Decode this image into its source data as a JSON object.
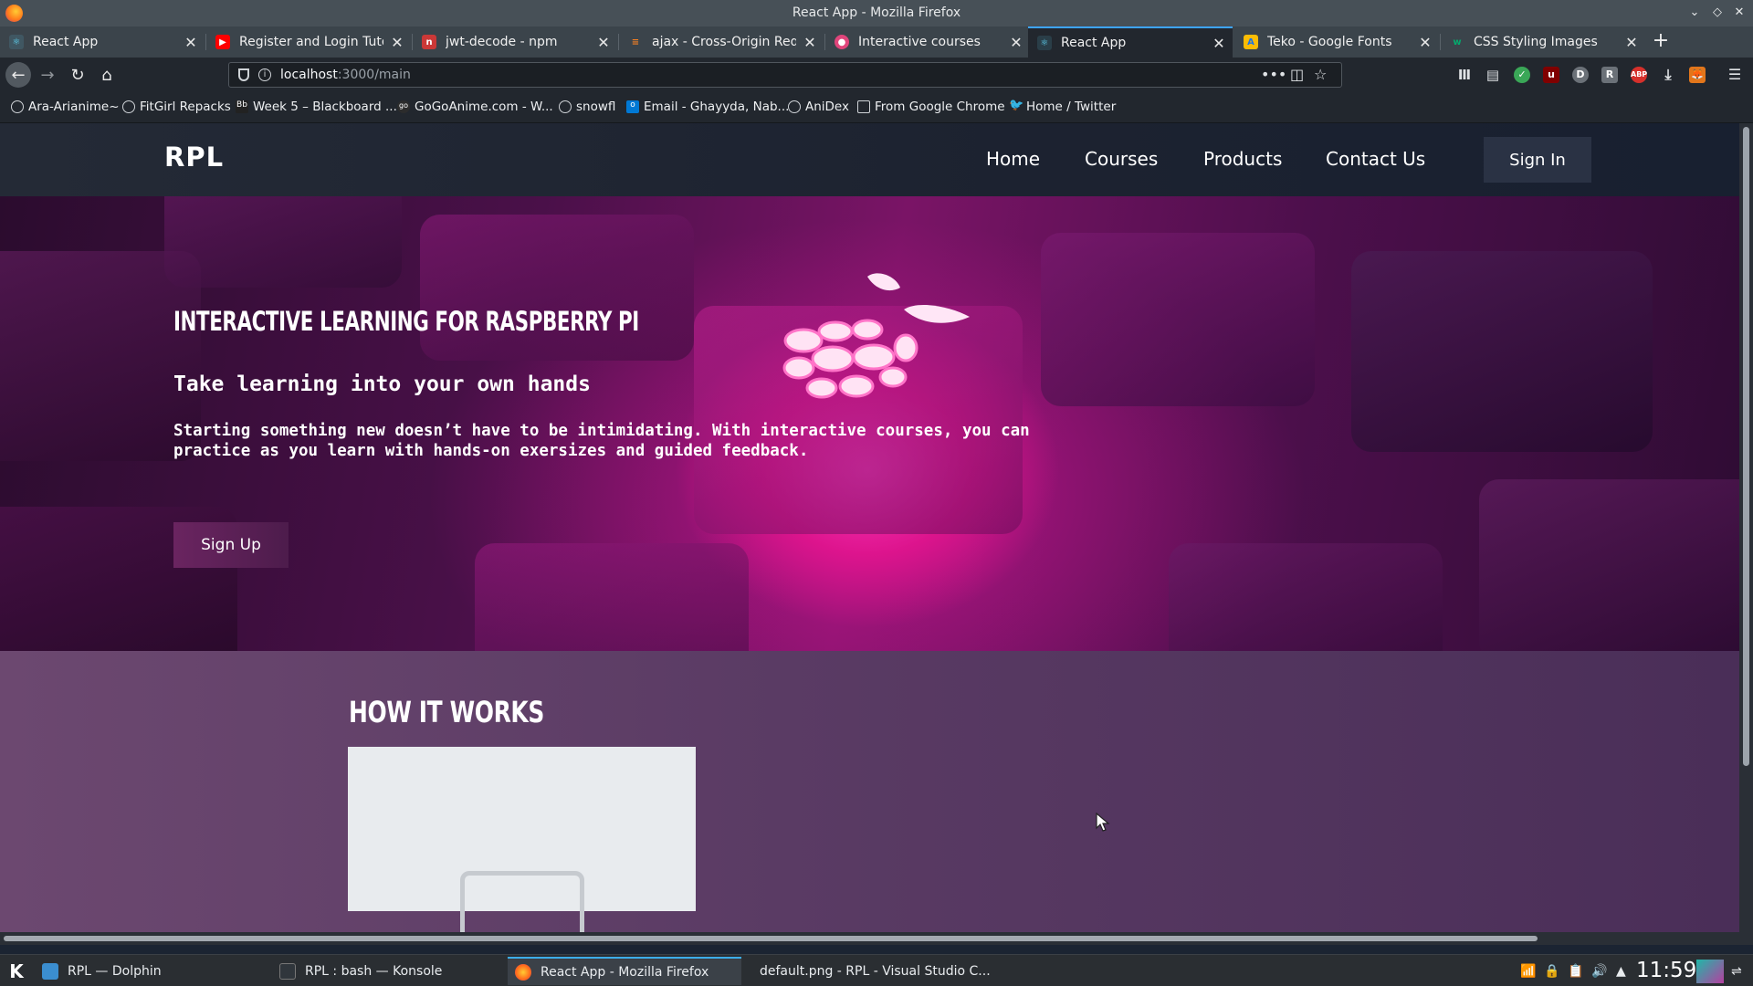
{
  "window": {
    "title": "React App - Mozilla Firefox"
  },
  "tabs": [
    {
      "label": "React App",
      "active": false,
      "favicon_color": "#61dafb"
    },
    {
      "label": "Register and Login Tutoria",
      "active": false,
      "favicon_color": "#ff0000"
    },
    {
      "label": "jwt-decode - npm",
      "active": false,
      "favicon_color": "#cb3837"
    },
    {
      "label": "ajax - Cross-Origin Reque",
      "active": false,
      "favicon_color": "#f48024"
    },
    {
      "label": "Interactive courses",
      "active": false,
      "favicon_color": "#e0457b"
    },
    {
      "label": "React App",
      "active": true,
      "favicon_color": "#61dafb"
    },
    {
      "label": "Teko - Google Fonts",
      "active": false,
      "favicon_color": "#fbbc04"
    },
    {
      "label": "CSS Styling Images",
      "active": false,
      "favicon_color": "#04aa6d"
    }
  ],
  "urlbar": {
    "host": "localhost",
    "path": ":3000/main"
  },
  "bookmarks": [
    {
      "label": "Ara-Arianime~"
    },
    {
      "label": "FitGirl Repacks"
    },
    {
      "label": "Week 5 – Blackboard ..."
    },
    {
      "label": "GoGoAnime.com - W..."
    },
    {
      "label": "snowfl"
    },
    {
      "label": "Email - Ghayyda, Nab..."
    },
    {
      "label": "AniDex"
    },
    {
      "label": "From Google Chrome"
    },
    {
      "label": "Home / Twitter"
    }
  ],
  "site": {
    "logo": "RPL",
    "nav": [
      "Home",
      "Courses",
      "Products",
      "Contact Us"
    ],
    "signin": "Sign In",
    "hero": {
      "title": "INTERACTIVE LEARNING FOR RASPBERRY PI",
      "subtitle": "Take learning into your own hands",
      "text": "Starting something new doesn’t have to be intimidating. With interactive courses, you can practice as you learn with hands-on exersizes and guided feedback.",
      "signup": "Sign Up"
    },
    "how_title": "HOW IT WORKS"
  },
  "taskbar": {
    "tasks": [
      {
        "label": "RPL — Dolphin",
        "active": false
      },
      {
        "label": "RPL : bash — Konsole",
        "active": false
      },
      {
        "label": "React App - Mozilla Firefox",
        "active": true
      },
      {
        "label": "default.png - RPL - Visual Studio C...",
        "active": false
      }
    ],
    "clock": "11:59"
  }
}
